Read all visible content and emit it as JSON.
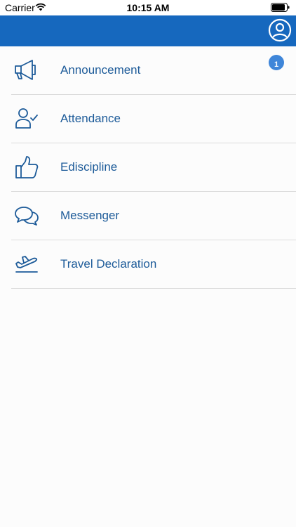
{
  "status_bar": {
    "carrier": "Carrier",
    "time": "10:15 AM"
  },
  "header": {
    "profile_icon": "user-circle-icon"
  },
  "menu": {
    "items": [
      {
        "label": "Announcement",
        "icon": "megaphone-icon",
        "badge": "1"
      },
      {
        "label": "Attendance",
        "icon": "user-check-icon"
      },
      {
        "label": "Ediscipline",
        "icon": "thumbs-up-icon"
      },
      {
        "label": "Messenger",
        "icon": "chat-bubbles-icon"
      },
      {
        "label": "Travel Declaration",
        "icon": "plane-departure-icon"
      }
    ]
  },
  "colors": {
    "header": "#1668be",
    "text": "#1d5b99",
    "badge": "#3f86d9",
    "background": "#fcfcfc"
  }
}
